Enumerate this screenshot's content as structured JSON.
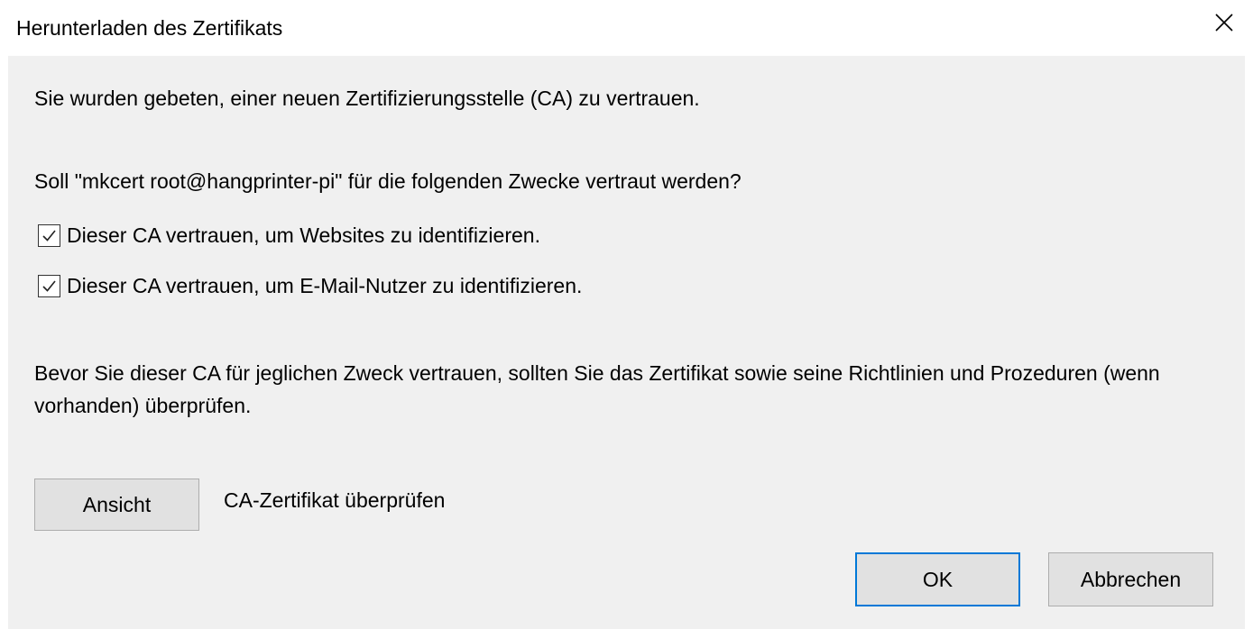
{
  "window": {
    "title": "Herunterladen des Zertifikats",
    "close_icon": "close-icon"
  },
  "dialog": {
    "intro": "Sie wurden gebeten, einer neuen Zertifizierungsstelle (CA) zu vertrauen.",
    "question": "Soll \"mkcert root@hangprinter-pi\" für die folgenden Zwecke vertraut werden?",
    "checkboxes": [
      {
        "label": "Dieser CA vertrauen, um Websites zu identifizieren.",
        "checked": true
      },
      {
        "label": "Dieser CA vertrauen, um E-Mail-Nutzer zu identifizieren.",
        "checked": true
      }
    ],
    "warning": "Bevor Sie dieser CA für jeglichen Zweck vertrauen, sollten Sie das Zertifikat sowie seine Richtlinien und Prozeduren (wenn vorhanden) überprüfen.",
    "view_button": "Ansicht",
    "view_description": "CA-Zertifikat überprüfen",
    "ok_button": "OK",
    "cancel_button": "Abbrechen"
  },
  "colors": {
    "content_background": "#f0f0f0",
    "button_background": "#e1e1e1",
    "default_button_border": "#0078d7"
  }
}
